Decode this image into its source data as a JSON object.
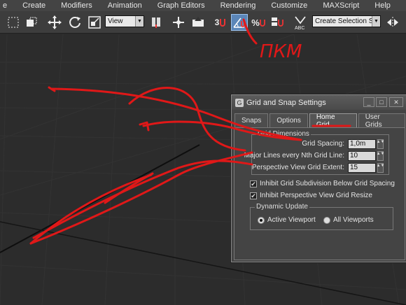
{
  "menu": [
    "e",
    "Create",
    "Modifiers",
    "Animation",
    "Graph Editors",
    "Rendering",
    "Customize",
    "MAXScript",
    "Help"
  ],
  "toolbar": {
    "view_dropdown": "View",
    "snap_label": "3",
    "percent_label": "%",
    "selection_set_placeholder": "Create Selection Se"
  },
  "annotation": {
    "handwritten_text": "ПКМ",
    "color": "#e01818"
  },
  "dialog": {
    "title": "Grid and Snap Settings",
    "tabs": [
      "Snaps",
      "Options",
      "Home Grid",
      "User Grids"
    ],
    "active_tab": "Home Grid",
    "grid_dimensions": {
      "label": "Grid Dimensions",
      "grid_spacing_label": "Grid Spacing:",
      "grid_spacing_value": "1,0m",
      "major_lines_label": "Major Lines every Nth Grid Line:",
      "major_lines_value": "10",
      "persp_extent_label": "Perspective View Grid Extent:",
      "persp_extent_value": "15"
    },
    "inhibit_subdivision_label": "Inhibit Grid Subdivision Below Grid Spacing",
    "inhibit_persp_resize_label": "Inhibit Perspective View Grid Resize",
    "dynamic_update": {
      "label": "Dynamic Update",
      "active_viewport_label": "Active Viewport",
      "all_viewports_label": "All Viewports",
      "selected": "Active Viewport"
    }
  }
}
